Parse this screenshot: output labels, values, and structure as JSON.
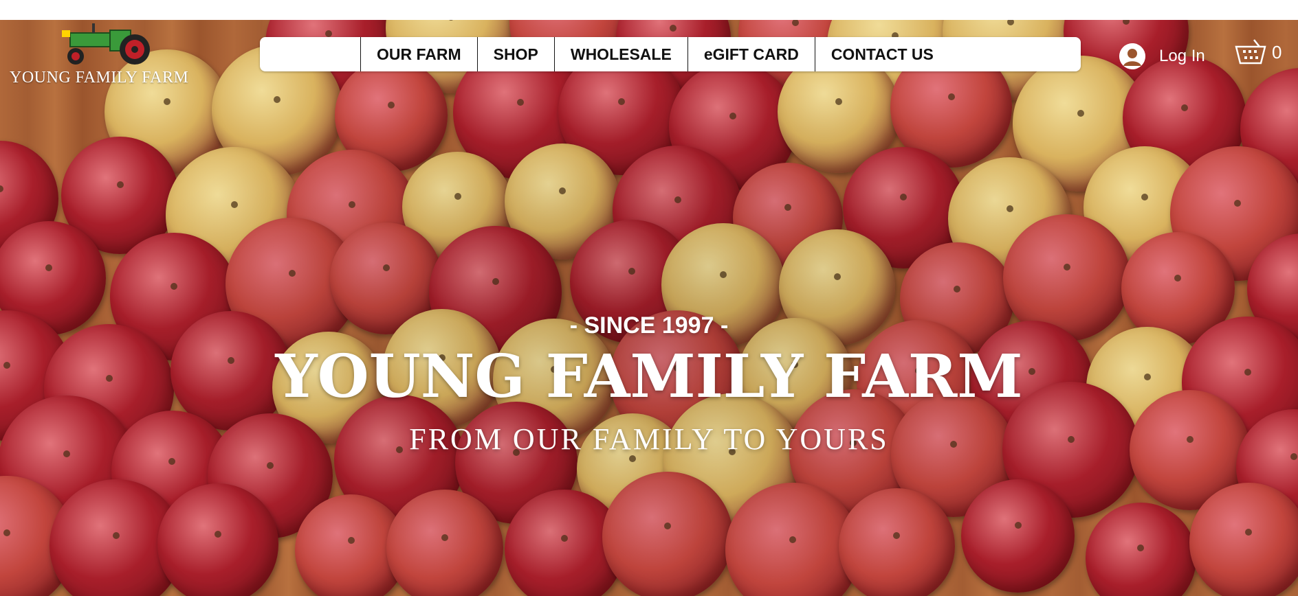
{
  "brand": {
    "logo_text": "YOUNG FAMILY FARM",
    "icon": "tractor-icon"
  },
  "nav": {
    "items": [
      {
        "label": "OUR FARM"
      },
      {
        "label": "SHOP"
      },
      {
        "label": "WHOLESALE"
      },
      {
        "label": "eGIFT CARD"
      },
      {
        "label": "CONTACT US"
      }
    ]
  },
  "account": {
    "login_label": "Log In",
    "icon": "user-avatar-icon"
  },
  "cart": {
    "count": "0",
    "icon": "cart-icon"
  },
  "hero": {
    "since": "- SINCE 1997 -",
    "title": "YOUNG FAMILY FARM",
    "subtitle": "FROM OUR FAMILY TO YOURS",
    "background": "apples-in-crate-image"
  },
  "colors": {
    "apple_red": "#b8232b",
    "apple_yellow": "#e3c06a",
    "crate_wood": "#a8603a",
    "tractor_green": "#3a9a3a"
  }
}
